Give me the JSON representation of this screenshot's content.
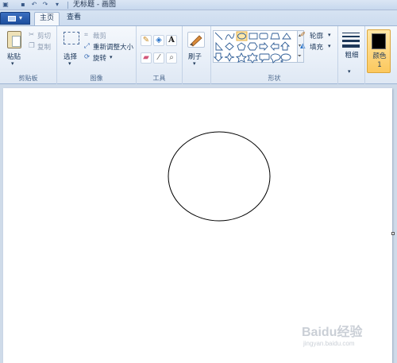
{
  "window": {
    "title": "无标题 - 画图"
  },
  "tabs": {
    "home": "主页",
    "view": "查看"
  },
  "clipboard": {
    "paste": "粘贴",
    "cut": "剪切",
    "copy": "复制",
    "label": "剪贴板"
  },
  "image": {
    "select": "选择",
    "crop": "裁剪",
    "resize": "重新调整大小",
    "rotate": "旋转",
    "label": "图像"
  },
  "tools": {
    "label": "工具",
    "text_glyph": "A"
  },
  "brushes": {
    "label": "刷子"
  },
  "shapes": {
    "label": "形状",
    "outline": "轮廓",
    "fill": "填充"
  },
  "size": {
    "label": "粗细"
  },
  "colors": {
    "color1": "颜色 1",
    "color1_value": "#000000"
  },
  "watermark": {
    "brand": "Baidu经验",
    "url": "jingyan.baidu.com"
  }
}
